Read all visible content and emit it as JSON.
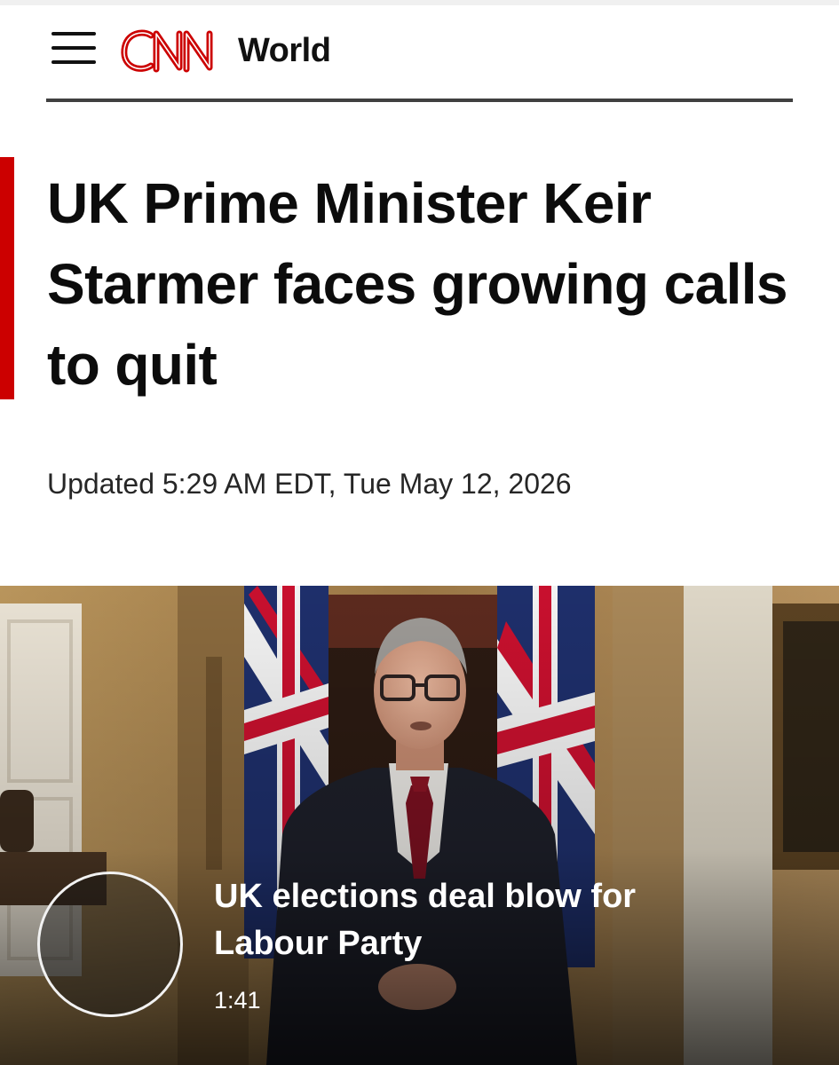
{
  "header": {
    "logo_text": "CNN",
    "section": "World"
  },
  "article": {
    "headline": "UK Prime Minister Keir Starmer faces growing calls to quit",
    "timestamp": "Updated 5:29 AM EDT, Tue May 12, 2026"
  },
  "video": {
    "title": "UK elections deal blow for Labour Party",
    "duration": "1:41"
  },
  "colors": {
    "brand_red": "#cc0000",
    "header_rule": "#404040",
    "text": "#0c0c0c"
  },
  "icons": {
    "menu": "hamburger-menu-icon",
    "play": "play-circle-icon"
  }
}
